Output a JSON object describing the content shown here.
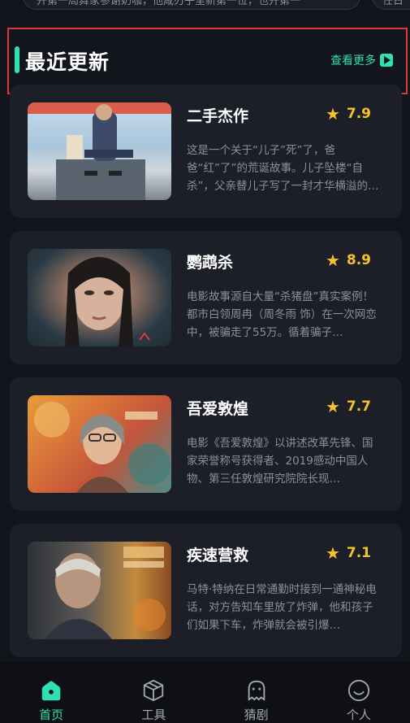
{
  "top_strip": {
    "left_text": "开第一局舞家参谢奶咖，他咸刃子里新第一位，也开第一",
    "right_text": "任日"
  },
  "section": {
    "title": "最近更新",
    "more_label": "查看更多"
  },
  "movies": [
    {
      "name": "二手杰作",
      "rating": "7.9",
      "description": "这是一个关于“儿子”死”了，爸爸“红”了”的荒诞故事。儿子坠楼“自杀”，父亲替儿子写了一封才华横溢的代笔…"
    },
    {
      "name": "鹦鹉杀",
      "rating": "8.9",
      "description": "电影故事源自大量“杀猪盘”真实案例！都市白领周冉（周冬雨 饰）在一次网恋中，被骗走了55万。循着骗子…"
    },
    {
      "name": "吾爱敦煌",
      "rating": "7.7",
      "description": "电影《吾爱敦煌》以讲述改革先锋、国家荣誉称号获得者、2019感动中国人物、第三任敦煌研究院院长现…"
    },
    {
      "name": "疾速营救",
      "rating": "7.1",
      "description": "马特·特纳在日常通勤时接到一通神秘电话，对方告知车里放了炸弹，他和孩子们如果下车，炸弹就会被引爆…"
    }
  ],
  "tabs": [
    {
      "label": "首页",
      "icon": "home-icon",
      "active": true
    },
    {
      "label": "工具",
      "icon": "box-icon",
      "active": false
    },
    {
      "label": "猜剧",
      "icon": "ghost-icon",
      "active": false
    },
    {
      "label": "个人",
      "icon": "smile-icon",
      "active": false
    }
  ],
  "colors": {
    "accent": "#2ee0b4",
    "rating": "#f5c12c",
    "highlight_border": "#e0353b",
    "background": "#13151c",
    "card": "#1c1f28"
  }
}
